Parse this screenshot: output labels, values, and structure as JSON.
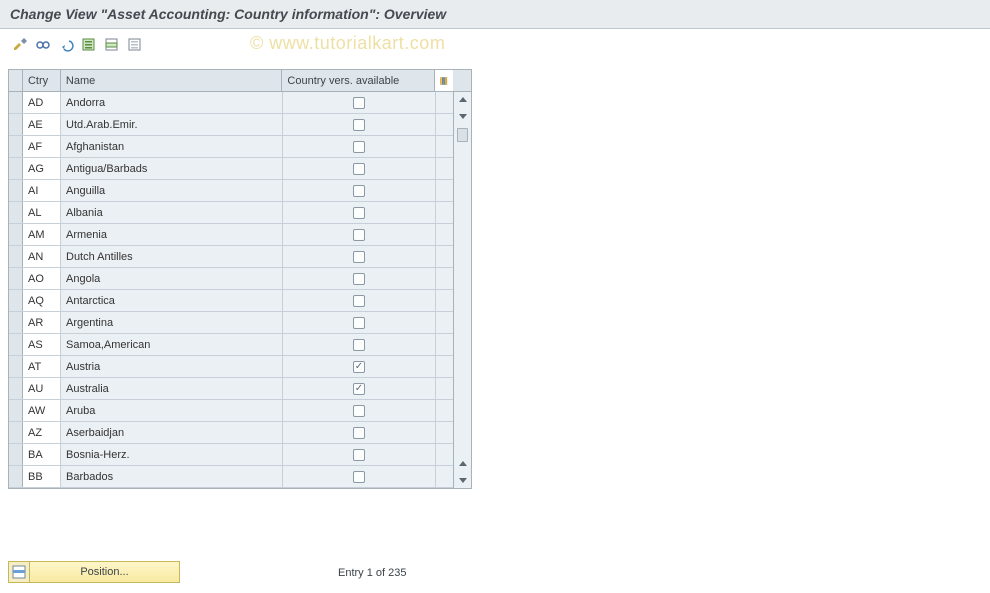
{
  "title": "Change View \"Asset Accounting: Country information\": Overview",
  "watermark": "© www.tutorialkart.com",
  "toolbar": {
    "icons": [
      {
        "name": "tools-icon"
      },
      {
        "name": "glasses-icon"
      },
      {
        "name": "undo-icon"
      },
      {
        "name": "select-all-icon"
      },
      {
        "name": "select-block-icon"
      },
      {
        "name": "deselect-all-icon"
      }
    ]
  },
  "table": {
    "headers": {
      "ctry": "Ctry",
      "name": "Name",
      "avail": "Country vers. available"
    },
    "rows": [
      {
        "ctry": "AD",
        "name": "Andorra",
        "avail": false
      },
      {
        "ctry": "AE",
        "name": "Utd.Arab.Emir.",
        "avail": false
      },
      {
        "ctry": "AF",
        "name": "Afghanistan",
        "avail": false
      },
      {
        "ctry": "AG",
        "name": "Antigua/Barbads",
        "avail": false
      },
      {
        "ctry": "AI",
        "name": "Anguilla",
        "avail": false
      },
      {
        "ctry": "AL",
        "name": "Albania",
        "avail": false
      },
      {
        "ctry": "AM",
        "name": "Armenia",
        "avail": false
      },
      {
        "ctry": "AN",
        "name": "Dutch Antilles",
        "avail": false
      },
      {
        "ctry": "AO",
        "name": "Angola",
        "avail": false
      },
      {
        "ctry": "AQ",
        "name": "Antarctica",
        "avail": false
      },
      {
        "ctry": "AR",
        "name": "Argentina",
        "avail": false
      },
      {
        "ctry": "AS",
        "name": "Samoa,American",
        "avail": false
      },
      {
        "ctry": "AT",
        "name": "Austria",
        "avail": true
      },
      {
        "ctry": "AU",
        "name": "Australia",
        "avail": true
      },
      {
        "ctry": "AW",
        "name": "Aruba",
        "avail": false
      },
      {
        "ctry": "AZ",
        "name": "Aserbaidjan",
        "avail": false
      },
      {
        "ctry": "BA",
        "name": "Bosnia-Herz.",
        "avail": false
      },
      {
        "ctry": "BB",
        "name": "Barbados",
        "avail": false
      }
    ]
  },
  "footer": {
    "position_label": "Position...",
    "entry_status": "Entry 1 of 235"
  }
}
